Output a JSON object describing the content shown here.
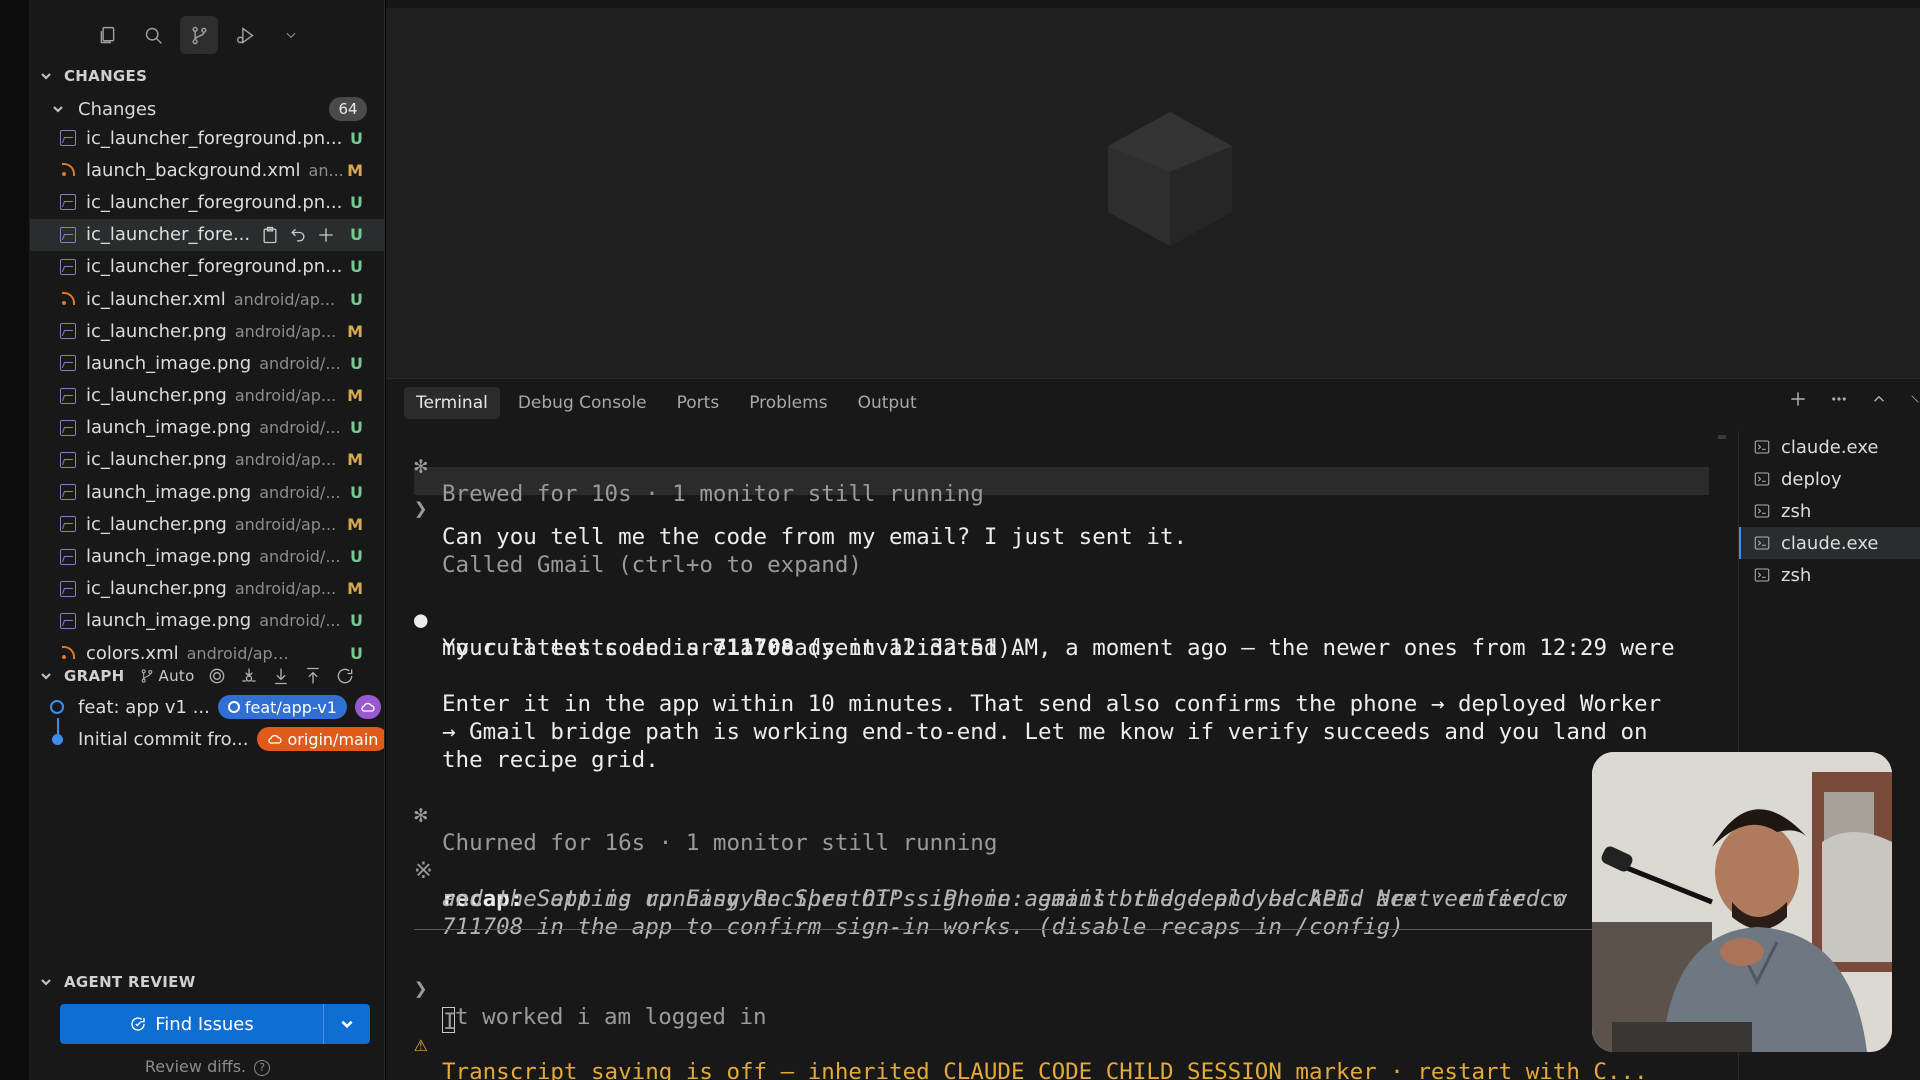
{
  "sidebar": {
    "toolbar": {
      "icons": [
        "explorer-icon",
        "search-icon",
        "source-control-icon",
        "run-debug-icon",
        "chevron-down-icon"
      ]
    },
    "changes_header": "CHANGES",
    "changes_group": {
      "label": "Changes",
      "count": "64"
    },
    "files": [
      {
        "name": "ic_launcher_foreground.pn...",
        "path": "",
        "status": "U",
        "icon": "image-icon"
      },
      {
        "name": "launch_background.xml",
        "path": "an...",
        "status": "M",
        "icon": "rss-icon"
      },
      {
        "name": "ic_launcher_foreground.pn...",
        "path": "",
        "status": "U",
        "icon": "image-icon"
      },
      {
        "name": "ic_launcher_fore...",
        "path": "",
        "status": "U",
        "icon": "image-icon",
        "selected": true
      },
      {
        "name": "ic_launcher_foreground.pn...",
        "path": "",
        "status": "U",
        "icon": "image-icon"
      },
      {
        "name": "ic_launcher.xml",
        "path": "android/ap...",
        "status": "U",
        "icon": "rss-icon"
      },
      {
        "name": "ic_launcher.png",
        "path": "android/ap...",
        "status": "M",
        "icon": "image-icon"
      },
      {
        "name": "launch_image.png",
        "path": "android/...",
        "status": "U",
        "icon": "image-icon"
      },
      {
        "name": "ic_launcher.png",
        "path": "android/ap...",
        "status": "M",
        "icon": "image-icon"
      },
      {
        "name": "launch_image.png",
        "path": "android/...",
        "status": "U",
        "icon": "image-icon"
      },
      {
        "name": "ic_launcher.png",
        "path": "android/ap...",
        "status": "M",
        "icon": "image-icon"
      },
      {
        "name": "launch_image.png",
        "path": "android/...",
        "status": "U",
        "icon": "image-icon"
      },
      {
        "name": "ic_launcher.png",
        "path": "android/ap...",
        "status": "M",
        "icon": "image-icon"
      },
      {
        "name": "launch_image.png",
        "path": "android/...",
        "status": "U",
        "icon": "image-icon"
      },
      {
        "name": "ic_launcher.png",
        "path": "android/ap...",
        "status": "M",
        "icon": "image-icon"
      },
      {
        "name": "launch_image.png",
        "path": "android/...",
        "status": "U",
        "icon": "image-icon"
      },
      {
        "name": "colors.xml",
        "path": "android/app/src/...",
        "status": "U",
        "icon": "rss-icon"
      }
    ],
    "graph": {
      "header": "GRAPH",
      "auto_label": "Auto",
      "commits": [
        {
          "message": "feat: app v1 ...",
          "branch": "feat/app-v1",
          "style": "current"
        },
        {
          "message": "Initial commit fro...",
          "branch": "origin/main",
          "style": "remote"
        }
      ]
    },
    "agent_review": {
      "header": "AGENT REVIEW",
      "button_label": "Find Issues",
      "hint": "Review diffs."
    }
  },
  "panel": {
    "tabs": [
      "Terminal",
      "Debug Console",
      "Ports",
      "Problems",
      "Output"
    ],
    "active_tab": "Terminal",
    "terminal": {
      "status_line_1": "Brewed for 10s · 1 monitor still running",
      "user_prompt": "Can you tell me the code from my email? I just sent it.",
      "tool_call": "Called Gmail (ctrl+o to expand)",
      "reply_line_1_pre": "Your latest code is ",
      "reply_code": "711708",
      "reply_line_1_post": " (sent 12:32:51 AM, a moment ago — the newer ones from 12:29 were",
      "reply_line_2": "my curl tests and are already invalidated).",
      "reply_para_2_line_1": "Enter it in the app within 10 minutes. That send also confirms the phone → deployed Worker",
      "reply_para_2_line_2": "→ Gmail bridge path is working end-to-end. Let me know if verify succeeds and you land on",
      "reply_para_2_line_3": "the recipe grid.",
      "status_line_2": "Churned for 16s · 1 monitor still running",
      "recap_label": "recap:",
      "recap_line_1": " Setting up EasyyRecipes OTP sign-in: email bridge and backend are verified w",
      "recap_line_2": "and the app is running on Shruthi's iPhone against the deployed API. Next: enter co",
      "recap_line_3": "711708 in the app to confirm sign-in works. (disable recaps in /config)",
      "input_text": "t worked i am logged in",
      "input_first_char": "I",
      "warning": "Transcript saving is off — inherited CLAUDE_CODE_CHILD_SESSION marker · restart with C..."
    },
    "terminal_list": [
      {
        "label": "claude.exe",
        "active": false
      },
      {
        "label": "deploy",
        "active": false
      },
      {
        "label": "zsh",
        "active": false
      },
      {
        "label": "claude.exe",
        "active": true
      },
      {
        "label": "zsh",
        "active": false
      }
    ]
  }
}
